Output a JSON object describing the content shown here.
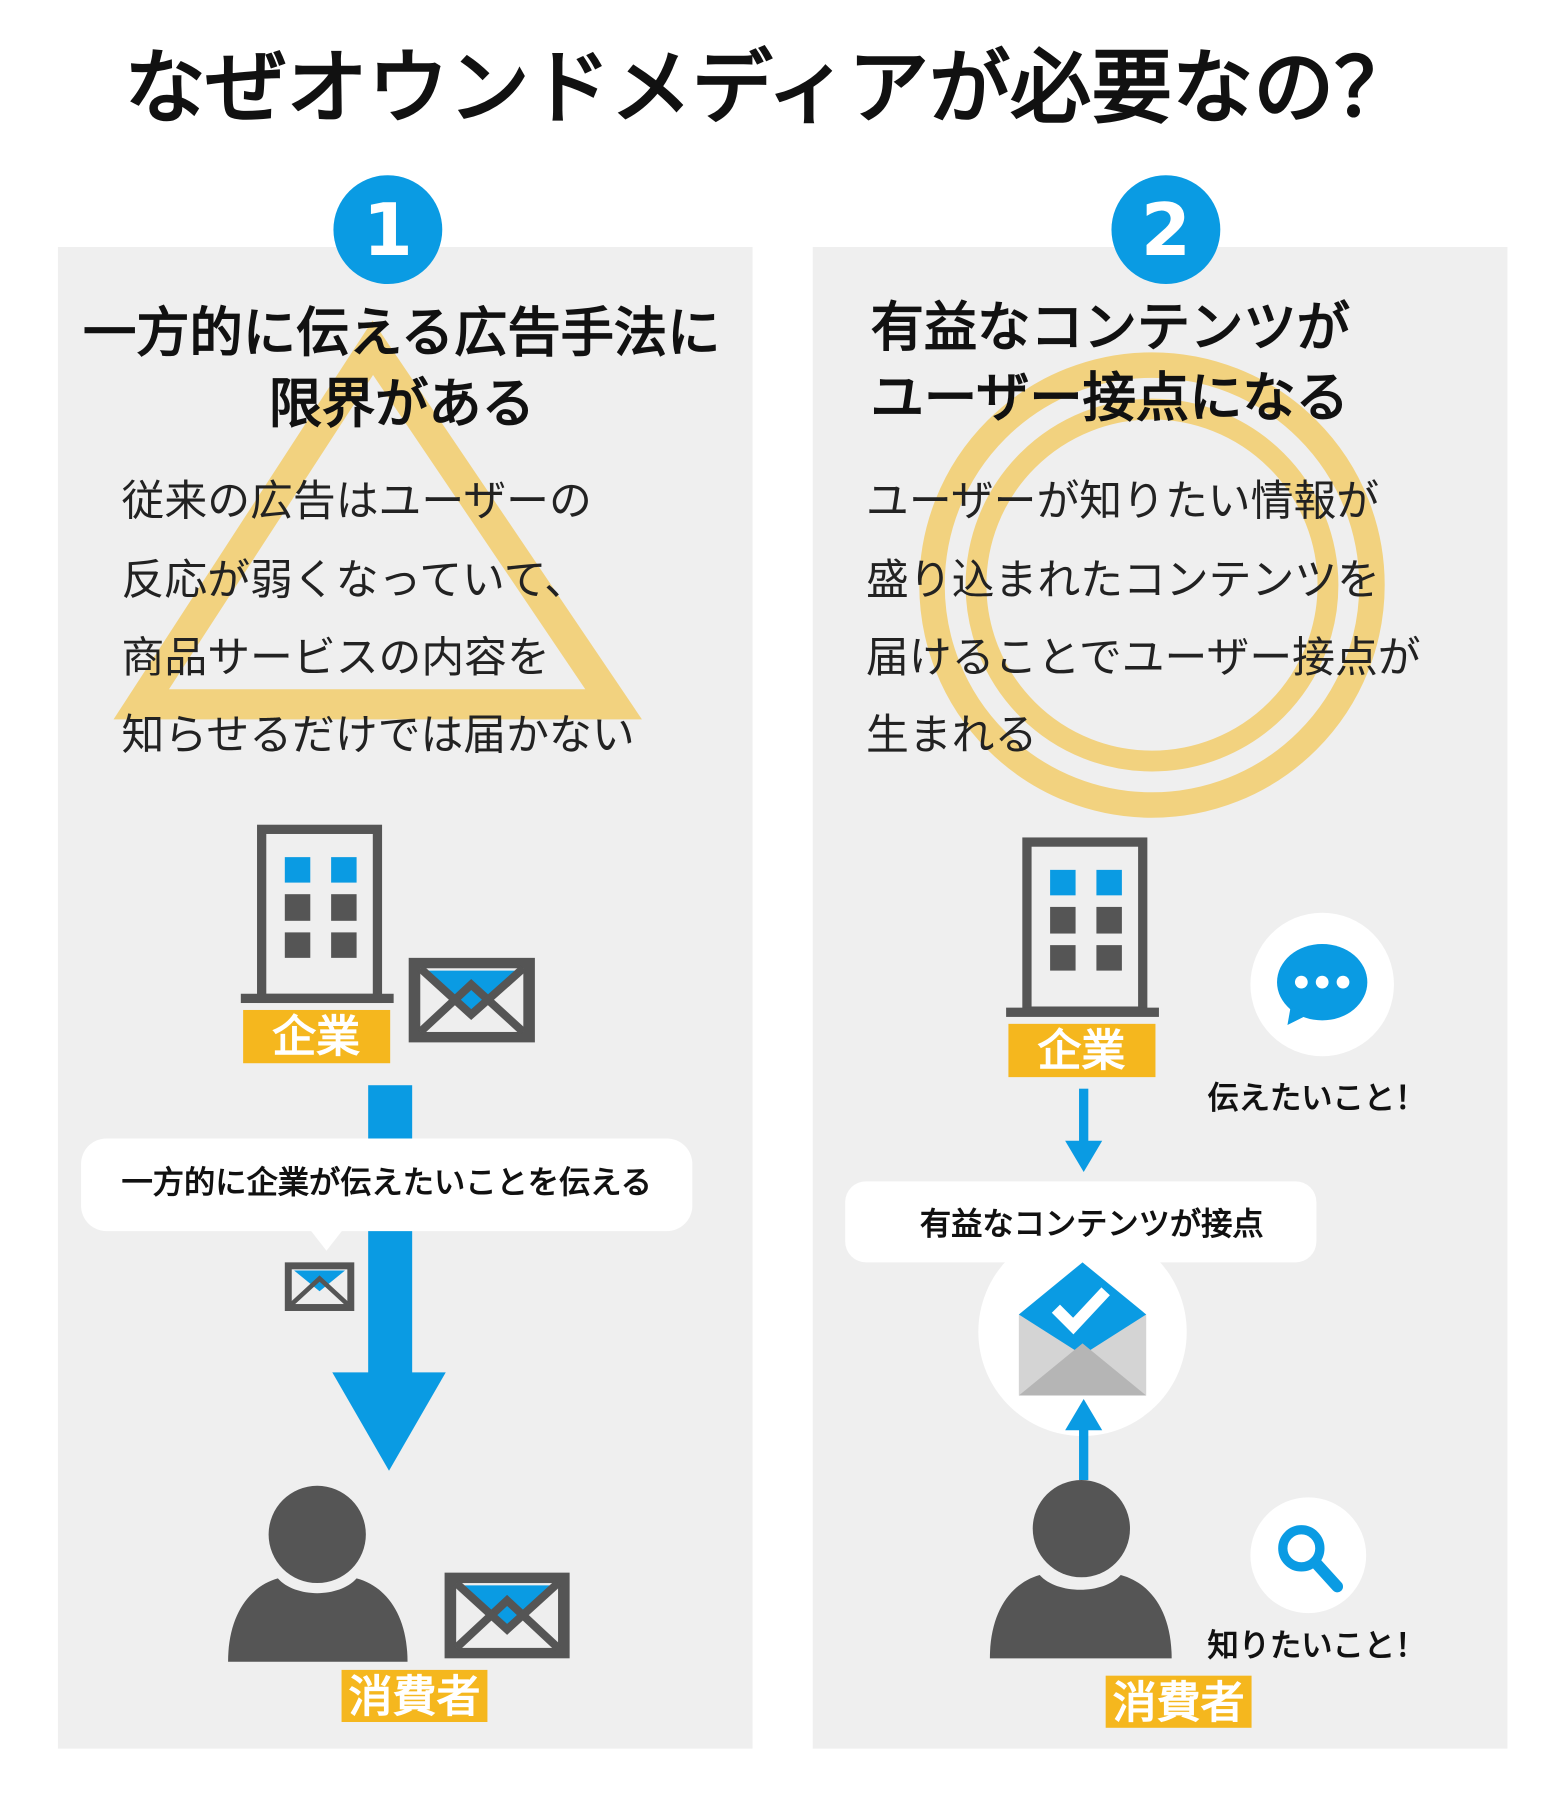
{
  "title": "なぜオウンドメディアが必要なの？",
  "colors": {
    "accent_blue": "#0a9be3",
    "label_yellow": "#f5b71e",
    "panel_gray": "#efefef",
    "icon_gray": "#555555",
    "decor_yellow": "#f2d27f"
  },
  "panels": [
    {
      "number": "1",
      "heading": [
        "一方的に伝える広告手法に",
        "限界がある"
      ],
      "body": [
        "従来の広告はユーザーの",
        "反応が弱くなっていて、",
        "商品サービスの内容を",
        "知らせるだけでは届かない"
      ],
      "decoration": "triangle",
      "company_label": "企業",
      "bubble": "一方的に企業が伝えたいことを伝える",
      "consumer_label": "消費者"
    },
    {
      "number": "2",
      "heading": [
        "有益なコンテンツが",
        "ユーザー接点になる"
      ],
      "body": [
        "ユーザーが知りたい情報が",
        "盛り込まれたコンテンツを",
        "届けることでユーザー接点が",
        "生まれる"
      ],
      "decoration": "double-circle",
      "company_label": "企業",
      "company_note": "伝えたいこと！",
      "bubble": "有益なコンテンツが接点",
      "consumer_label": "消費者",
      "consumer_note": "知りたいこと！"
    }
  ]
}
